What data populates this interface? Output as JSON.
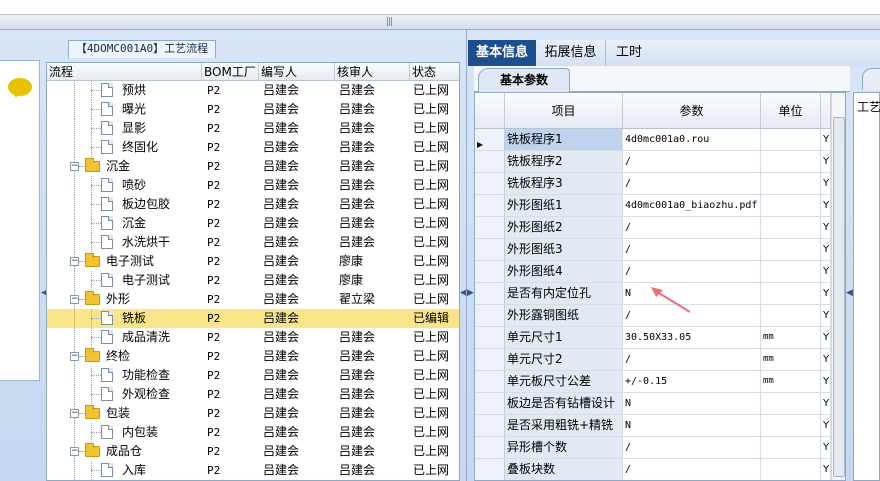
{
  "left_panel": {
    "title": "【4DOMC001A0】工艺流程",
    "columns": [
      "流程",
      "BOM工厂",
      "编写人",
      "核审人",
      "状态"
    ],
    "rows": [
      {
        "level": 2,
        "kind": "doc",
        "name": "预烘",
        "bom": "P2",
        "writer": "吕建会",
        "reviewer": "吕建会",
        "status": "已上网",
        "selected": false
      },
      {
        "level": 2,
        "kind": "doc",
        "name": "曝光",
        "bom": "P2",
        "writer": "吕建会",
        "reviewer": "吕建会",
        "status": "已上网",
        "selected": false
      },
      {
        "level": 2,
        "kind": "doc",
        "name": "显影",
        "bom": "P2",
        "writer": "吕建会",
        "reviewer": "吕建会",
        "status": "已上网",
        "selected": false
      },
      {
        "level": 2,
        "kind": "doc",
        "name": "终固化",
        "bom": "P2",
        "writer": "吕建会",
        "reviewer": "吕建会",
        "status": "已上网",
        "selected": false
      },
      {
        "level": 1,
        "kind": "folder",
        "name": "沉金",
        "bom": "P2",
        "writer": "吕建会",
        "reviewer": "吕建会",
        "status": "已上网",
        "selected": false
      },
      {
        "level": 2,
        "kind": "doc",
        "name": "喷砂",
        "bom": "P2",
        "writer": "吕建会",
        "reviewer": "吕建会",
        "status": "已上网",
        "selected": false
      },
      {
        "level": 2,
        "kind": "doc",
        "name": "板边包胶",
        "bom": "P2",
        "writer": "吕建会",
        "reviewer": "吕建会",
        "status": "已上网",
        "selected": false
      },
      {
        "level": 2,
        "kind": "doc",
        "name": "沉金",
        "bom": "P2",
        "writer": "吕建会",
        "reviewer": "吕建会",
        "status": "已上网",
        "selected": false
      },
      {
        "level": 2,
        "kind": "doc",
        "name": "水洗烘干",
        "bom": "P2",
        "writer": "吕建会",
        "reviewer": "吕建会",
        "status": "已上网",
        "selected": false
      },
      {
        "level": 1,
        "kind": "folder",
        "name": "电子测试",
        "bom": "P2",
        "writer": "吕建会",
        "reviewer": "廖康",
        "status": "已上网",
        "selected": false
      },
      {
        "level": 2,
        "kind": "doc",
        "name": "电子测试",
        "bom": "P2",
        "writer": "吕建会",
        "reviewer": "廖康",
        "status": "已上网",
        "selected": false
      },
      {
        "level": 1,
        "kind": "folder",
        "name": "外形",
        "bom": "P2",
        "writer": "吕建会",
        "reviewer": "翟立梁",
        "status": "已上网",
        "selected": false
      },
      {
        "level": 2,
        "kind": "doc",
        "name": "铣板",
        "bom": "P2",
        "writer": "吕建会",
        "reviewer": "",
        "status": "已编辑",
        "selected": true
      },
      {
        "level": 2,
        "kind": "doc",
        "name": "成品清洗",
        "bom": "P2",
        "writer": "吕建会",
        "reviewer": "吕建会",
        "status": "已上网",
        "selected": false
      },
      {
        "level": 1,
        "kind": "folder",
        "name": "终检",
        "bom": "P2",
        "writer": "吕建会",
        "reviewer": "吕建会",
        "status": "已上网",
        "selected": false
      },
      {
        "level": 2,
        "kind": "doc",
        "name": "功能检查",
        "bom": "P2",
        "writer": "吕建会",
        "reviewer": "吕建会",
        "status": "已上网",
        "selected": false
      },
      {
        "level": 2,
        "kind": "doc",
        "name": "外观检查",
        "bom": "P2",
        "writer": "吕建会",
        "reviewer": "吕建会",
        "status": "已上网",
        "selected": false
      },
      {
        "level": 1,
        "kind": "folder",
        "name": "包装",
        "bom": "P2",
        "writer": "吕建会",
        "reviewer": "吕建会",
        "status": "已上网",
        "selected": false
      },
      {
        "level": 2,
        "kind": "doc",
        "name": "内包装",
        "bom": "P2",
        "writer": "吕建会",
        "reviewer": "吕建会",
        "status": "已上网",
        "selected": false
      },
      {
        "level": 1,
        "kind": "folder",
        "name": "成品仓",
        "bom": "P2",
        "writer": "吕建会",
        "reviewer": "吕建会",
        "status": "已上网",
        "selected": false
      },
      {
        "level": 2,
        "kind": "doc",
        "name": "入库",
        "bom": "P2",
        "writer": "吕建会",
        "reviewer": "吕建会",
        "status": "已上网",
        "selected": false
      }
    ]
  },
  "right_panel": {
    "tabs": [
      "基本信息",
      "拓展信息",
      "工时"
    ],
    "subtab": "基本参数",
    "columns": [
      "项目",
      "参数",
      "单位"
    ],
    "rows": [
      {
        "item": "铣板程序1",
        "param": "4d0mc001a0.rou",
        "unit": "",
        "extra": "Y"
      },
      {
        "item": "铣板程序2",
        "param": "/",
        "unit": "",
        "extra": "Y"
      },
      {
        "item": "铣板程序3",
        "param": "/",
        "unit": "",
        "extra": "Y"
      },
      {
        "item": "外形图纸1",
        "param": "4d0mc001a0_biaozhu.pdf",
        "unit": "",
        "extra": "Y"
      },
      {
        "item": "外形图纸2",
        "param": "/",
        "unit": "",
        "extra": "Y"
      },
      {
        "item": "外形图纸3",
        "param": "/",
        "unit": "",
        "extra": "Y"
      },
      {
        "item": "外形图纸4",
        "param": "/",
        "unit": "",
        "extra": "Y"
      },
      {
        "item": "是否有内定位孔",
        "param": "N",
        "unit": "",
        "extra": "Y"
      },
      {
        "item": "外形露铜图纸",
        "param": "/",
        "unit": "",
        "extra": "Y"
      },
      {
        "item": "单元尺寸1",
        "param": "30.50X33.05",
        "unit": "mm",
        "extra": "Y"
      },
      {
        "item": "单元尺寸2",
        "param": "/",
        "unit": "mm",
        "extra": "Y"
      },
      {
        "item": "单元板尺寸公差",
        "param": "+/-0.15",
        "unit": "mm",
        "extra": "Y"
      },
      {
        "item": "板边是否有钻槽设计",
        "param": "N",
        "unit": "",
        "extra": "Y"
      },
      {
        "item": "是否采用粗铣+精铣",
        "param": "N",
        "unit": "",
        "extra": "Y"
      },
      {
        "item": "异形槽个数",
        "param": "/",
        "unit": "",
        "extra": "Y"
      },
      {
        "item": "叠板块数",
        "param": "/",
        "unit": "",
        "extra": "Y"
      }
    ],
    "side_label": "工艺"
  },
  "colors": {
    "frame": "#c9dbf1",
    "selected_row": "#fbe58b",
    "active_tab": "#1d4e8f",
    "annotation_arrow": "#e8707a"
  }
}
